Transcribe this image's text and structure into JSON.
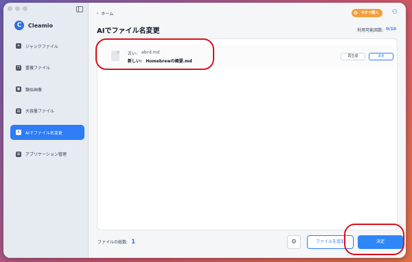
{
  "sidebar": {
    "brand": "Cleamio",
    "items": [
      {
        "label": "ジャンクファイル",
        "icon": "broom-icon"
      },
      {
        "label": "重複ファイル",
        "icon": "duplicate-icon"
      },
      {
        "label": "類似画像",
        "icon": "image-icon"
      },
      {
        "label": "大容量ファイル",
        "icon": "large-file-icon"
      },
      {
        "label": "AIでファイル名変更",
        "icon": "ai-rename-icon",
        "active": true
      },
      {
        "label": "アプリケーション管理",
        "icon": "app-icon"
      }
    ]
  },
  "header": {
    "back_label": "ホーム",
    "promo_label": "今すぐ購入",
    "page_title": "AIでファイル名変更",
    "usage_label": "利用可能回数:",
    "usage_count": "0/10"
  },
  "rename_row": {
    "old_label": "古い:",
    "old_value": "abcd.md",
    "new_label": "新しい:",
    "new_value": "Homebrewの概要.md",
    "regenerate_label": "再生成",
    "decide_label": "決定"
  },
  "footer": {
    "total_label": "ファイルの総数:",
    "total_count": "1",
    "add_label": "ファイルを追加",
    "apply_label": "決定"
  },
  "colors": {
    "accent": "#2e7cf6",
    "promo": "#f59e3b",
    "annotation": "#d90f1b"
  }
}
